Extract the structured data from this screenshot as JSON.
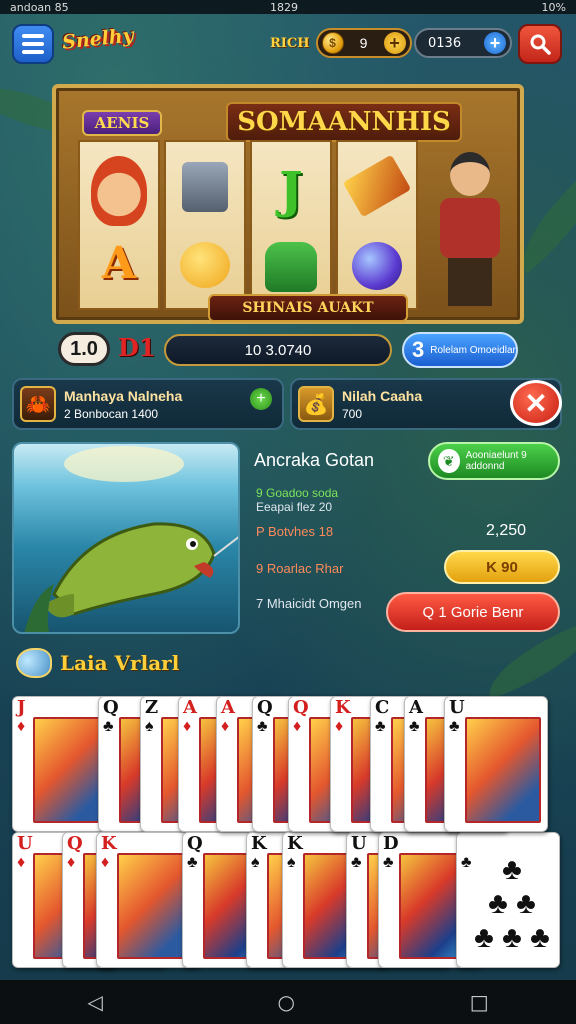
{
  "status_bar": {
    "left": "andoan 85",
    "time": "1829",
    "battery": "10%"
  },
  "header": {
    "logo": "Snelhy",
    "coin_label": "RICH",
    "coins": "9",
    "gems": "0136"
  },
  "slot": {
    "badge": "AENIS",
    "title": "SOMAANNHIS",
    "caption": "SHINAIS AUAKT",
    "reel_symbols": [
      "A",
      "J"
    ]
  },
  "stats_row": {
    "level": "1.0",
    "red_value": "D1",
    "score": "10 3.0740",
    "promo_number": "3",
    "promo_text": "Rolelam Omoeidlar"
  },
  "user_cards": [
    {
      "name": "Manhaya Nalneha",
      "sub": "2 Bonbocan 1400"
    },
    {
      "name": "Nilah Caaha",
      "sub": "700"
    }
  ],
  "catch": {
    "title": "Ancraka Gotan",
    "green_button": "Aooniaelunt 9 addonnd",
    "stat1": "9 Goadoo soda",
    "stat1b": "Eeapai flez 20",
    "stat2_label": "P Botvhes 18",
    "stat2_value": "2,250",
    "stat3_label": "9 Roarlac Rhar",
    "yellow_button": "K 90",
    "stat4_label": "7 Mhaicidt Omgen",
    "red_button": "Q 1 Gorie Benr"
  },
  "section": {
    "title": "Laia Vrlarl"
  },
  "cards_row1": [
    {
      "rank": "J",
      "suit": "♦",
      "color": "red"
    },
    {
      "rank": "Q",
      "suit": "♣",
      "color": "blk"
    },
    {
      "rank": "Z",
      "suit": "♠",
      "color": "blk"
    },
    {
      "rank": "A",
      "suit": "♦",
      "color": "red"
    },
    {
      "rank": "A",
      "suit": "♦",
      "color": "red"
    },
    {
      "rank": "Q",
      "suit": "♣",
      "color": "blk"
    },
    {
      "rank": "Q",
      "suit": "♦",
      "color": "red"
    },
    {
      "rank": "K",
      "suit": "♦",
      "color": "red"
    },
    {
      "rank": "C",
      "suit": "♣",
      "color": "blk"
    },
    {
      "rank": "A",
      "suit": "♣",
      "color": "blk"
    },
    {
      "rank": "U",
      "suit": "♣",
      "color": "blk"
    }
  ],
  "cards_row2": [
    {
      "rank": "U",
      "suit": "♦",
      "color": "red"
    },
    {
      "rank": "Q",
      "suit": "♦",
      "color": "red"
    },
    {
      "rank": "K",
      "suit": "♦",
      "color": "red"
    },
    {
      "rank": "Q",
      "suit": "♣",
      "color": "blk"
    },
    {
      "rank": "K",
      "suit": "♠",
      "color": "blk"
    },
    {
      "rank": "K",
      "suit": "♠",
      "color": "blk"
    },
    {
      "rank": "U",
      "suit": "♣",
      "color": "blk"
    },
    {
      "rank": "D",
      "suit": "♣",
      "color": "blk"
    },
    {
      "rank": "",
      "suit": "♣",
      "color": "blk"
    }
  ],
  "navbar": {
    "back": "◁",
    "home": "○",
    "recent": "□"
  },
  "colors": {
    "accent_gold": "#ffcf3a",
    "button_red": "#c4201a",
    "button_green": "#1d8a23",
    "button_blue": "#1b5fd1"
  }
}
